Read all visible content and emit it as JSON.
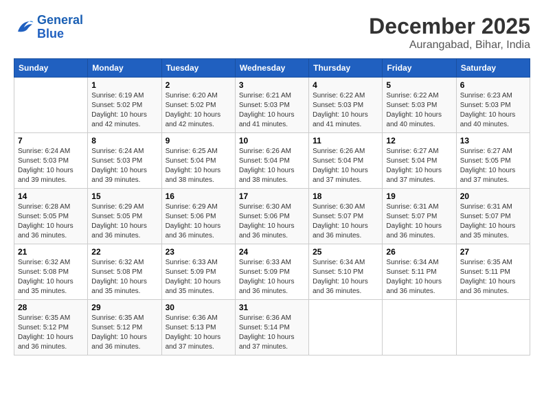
{
  "header": {
    "logo_line1": "General",
    "logo_line2": "Blue",
    "month": "December 2025",
    "location": "Aurangabad, Bihar, India"
  },
  "days_of_week": [
    "Sunday",
    "Monday",
    "Tuesday",
    "Wednesday",
    "Thursday",
    "Friday",
    "Saturday"
  ],
  "weeks": [
    [
      {
        "day": "",
        "info": ""
      },
      {
        "day": "1",
        "info": "Sunrise: 6:19 AM\nSunset: 5:02 PM\nDaylight: 10 hours\nand 42 minutes."
      },
      {
        "day": "2",
        "info": "Sunrise: 6:20 AM\nSunset: 5:02 PM\nDaylight: 10 hours\nand 42 minutes."
      },
      {
        "day": "3",
        "info": "Sunrise: 6:21 AM\nSunset: 5:03 PM\nDaylight: 10 hours\nand 41 minutes."
      },
      {
        "day": "4",
        "info": "Sunrise: 6:22 AM\nSunset: 5:03 PM\nDaylight: 10 hours\nand 41 minutes."
      },
      {
        "day": "5",
        "info": "Sunrise: 6:22 AM\nSunset: 5:03 PM\nDaylight: 10 hours\nand 40 minutes."
      },
      {
        "day": "6",
        "info": "Sunrise: 6:23 AM\nSunset: 5:03 PM\nDaylight: 10 hours\nand 40 minutes."
      }
    ],
    [
      {
        "day": "7",
        "info": "Sunrise: 6:24 AM\nSunset: 5:03 PM\nDaylight: 10 hours\nand 39 minutes."
      },
      {
        "day": "8",
        "info": "Sunrise: 6:24 AM\nSunset: 5:03 PM\nDaylight: 10 hours\nand 39 minutes."
      },
      {
        "day": "9",
        "info": "Sunrise: 6:25 AM\nSunset: 5:04 PM\nDaylight: 10 hours\nand 38 minutes."
      },
      {
        "day": "10",
        "info": "Sunrise: 6:26 AM\nSunset: 5:04 PM\nDaylight: 10 hours\nand 38 minutes."
      },
      {
        "day": "11",
        "info": "Sunrise: 6:26 AM\nSunset: 5:04 PM\nDaylight: 10 hours\nand 37 minutes."
      },
      {
        "day": "12",
        "info": "Sunrise: 6:27 AM\nSunset: 5:04 PM\nDaylight: 10 hours\nand 37 minutes."
      },
      {
        "day": "13",
        "info": "Sunrise: 6:27 AM\nSunset: 5:05 PM\nDaylight: 10 hours\nand 37 minutes."
      }
    ],
    [
      {
        "day": "14",
        "info": "Sunrise: 6:28 AM\nSunset: 5:05 PM\nDaylight: 10 hours\nand 36 minutes."
      },
      {
        "day": "15",
        "info": "Sunrise: 6:29 AM\nSunset: 5:05 PM\nDaylight: 10 hours\nand 36 minutes."
      },
      {
        "day": "16",
        "info": "Sunrise: 6:29 AM\nSunset: 5:06 PM\nDaylight: 10 hours\nand 36 minutes."
      },
      {
        "day": "17",
        "info": "Sunrise: 6:30 AM\nSunset: 5:06 PM\nDaylight: 10 hours\nand 36 minutes."
      },
      {
        "day": "18",
        "info": "Sunrise: 6:30 AM\nSunset: 5:07 PM\nDaylight: 10 hours\nand 36 minutes."
      },
      {
        "day": "19",
        "info": "Sunrise: 6:31 AM\nSunset: 5:07 PM\nDaylight: 10 hours\nand 36 minutes."
      },
      {
        "day": "20",
        "info": "Sunrise: 6:31 AM\nSunset: 5:07 PM\nDaylight: 10 hours\nand 35 minutes."
      }
    ],
    [
      {
        "day": "21",
        "info": "Sunrise: 6:32 AM\nSunset: 5:08 PM\nDaylight: 10 hours\nand 35 minutes."
      },
      {
        "day": "22",
        "info": "Sunrise: 6:32 AM\nSunset: 5:08 PM\nDaylight: 10 hours\nand 35 minutes."
      },
      {
        "day": "23",
        "info": "Sunrise: 6:33 AM\nSunset: 5:09 PM\nDaylight: 10 hours\nand 35 minutes."
      },
      {
        "day": "24",
        "info": "Sunrise: 6:33 AM\nSunset: 5:09 PM\nDaylight: 10 hours\nand 36 minutes."
      },
      {
        "day": "25",
        "info": "Sunrise: 6:34 AM\nSunset: 5:10 PM\nDaylight: 10 hours\nand 36 minutes."
      },
      {
        "day": "26",
        "info": "Sunrise: 6:34 AM\nSunset: 5:11 PM\nDaylight: 10 hours\nand 36 minutes."
      },
      {
        "day": "27",
        "info": "Sunrise: 6:35 AM\nSunset: 5:11 PM\nDaylight: 10 hours\nand 36 minutes."
      }
    ],
    [
      {
        "day": "28",
        "info": "Sunrise: 6:35 AM\nSunset: 5:12 PM\nDaylight: 10 hours\nand 36 minutes."
      },
      {
        "day": "29",
        "info": "Sunrise: 6:35 AM\nSunset: 5:12 PM\nDaylight: 10 hours\nand 36 minutes."
      },
      {
        "day": "30",
        "info": "Sunrise: 6:36 AM\nSunset: 5:13 PM\nDaylight: 10 hours\nand 37 minutes."
      },
      {
        "day": "31",
        "info": "Sunrise: 6:36 AM\nSunset: 5:14 PM\nDaylight: 10 hours\nand 37 minutes."
      },
      {
        "day": "",
        "info": ""
      },
      {
        "day": "",
        "info": ""
      },
      {
        "day": "",
        "info": ""
      }
    ]
  ]
}
